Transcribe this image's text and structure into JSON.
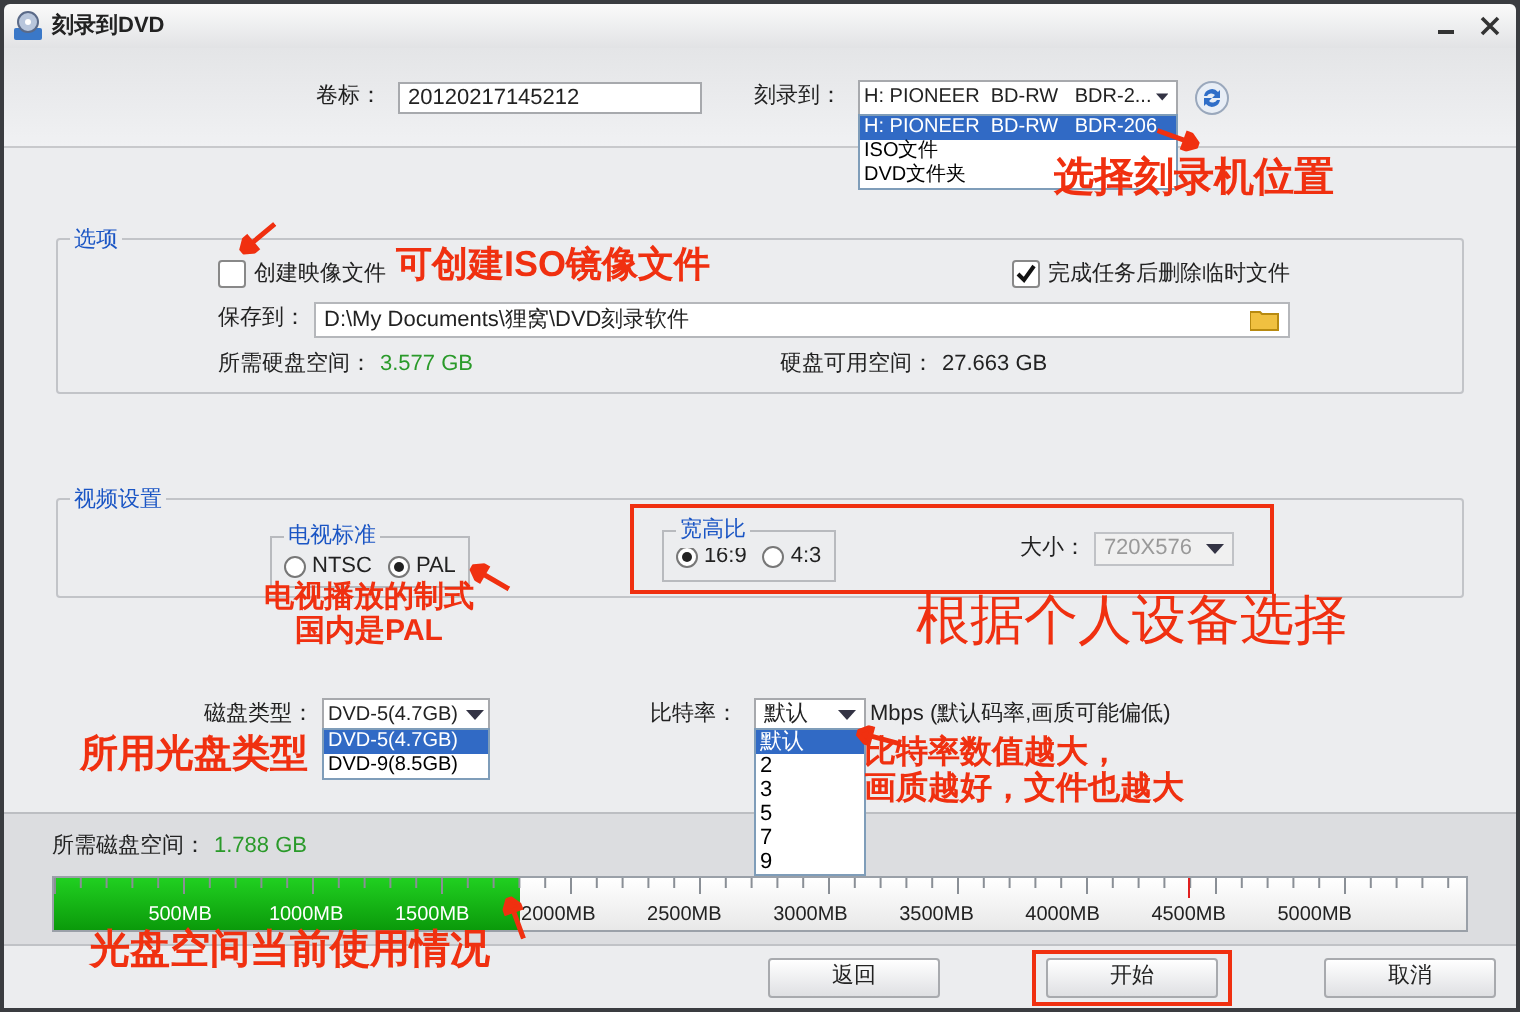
{
  "window": {
    "title": "刻录到DVD"
  },
  "volume": {
    "label": "卷标：",
    "value": "20120217145212"
  },
  "burn_to": {
    "label": "刻录到：",
    "value": "H: PIONEER  BD-RW   BDR-2...",
    "options": [
      {
        "label": "H: PIONEER  BD-RW   BDR-206",
        "selected": true
      },
      {
        "label": "ISO文件",
        "selected": false
      },
      {
        "label": "DVD文件夹",
        "selected": false
      }
    ]
  },
  "options": {
    "title": "选项",
    "create_image": {
      "label": "创建映像文件",
      "checked": false
    },
    "delete_temp": {
      "label": "完成任务后删除临时文件",
      "checked": true
    },
    "save_to": {
      "label": "保存到：",
      "value": "D:\\My Documents\\狸窝\\DVD刻录软件"
    },
    "required_space": {
      "label": "所需硬盘空间：",
      "value": "3.577 GB"
    },
    "free_space": {
      "label": "硬盘可用空间：",
      "value": "27.663 GB"
    }
  },
  "video": {
    "title": "视频设置",
    "tv_standard": {
      "title": "电视标准",
      "options": [
        {
          "label": "NTSC",
          "selected": false
        },
        {
          "label": "PAL",
          "selected": true
        }
      ]
    },
    "aspect": {
      "title": "宽高比",
      "options": [
        {
          "label": "16:9",
          "selected": true
        },
        {
          "label": "4:3",
          "selected": false
        }
      ]
    },
    "size": {
      "label": "大小：",
      "value": "720X576",
      "disabled": true
    }
  },
  "disc_type": {
    "label": "磁盘类型：",
    "value": "DVD-5(4.7GB)",
    "options": [
      {
        "label": "DVD-5(4.7GB)",
        "selected": true
      },
      {
        "label": "DVD-9(8.5GB)",
        "selected": false
      }
    ]
  },
  "bitrate": {
    "label": "比特率：",
    "value": "默认",
    "unit": "Mbps (默认码率,画质可能偏低)",
    "options": [
      {
        "label": "默认",
        "selected": true
      },
      {
        "label": "2",
        "selected": false
      },
      {
        "label": "3",
        "selected": false
      },
      {
        "label": "5",
        "selected": false
      },
      {
        "label": "7",
        "selected": false
      },
      {
        "label": "9",
        "selected": false
      }
    ]
  },
  "disc_usage": {
    "label": "所需磁盘空间：",
    "value": "1.788 GB",
    "level": 0.33,
    "ticks": [
      "500MB",
      "1000MB",
      "1500MB",
      "2000MB",
      "2500MB",
      "3000MB",
      "3500MB",
      "4000MB",
      "4500MB",
      "5000MB"
    ]
  },
  "buttons": [
    {
      "label": "返回"
    },
    {
      "label": "开始"
    },
    {
      "label": "取消"
    }
  ],
  "annotations": [
    {
      "lines": [
        "选择刻录机位置"
      ]
    },
    {
      "lines": [
        "可创建ISO镜像文件"
      ]
    },
    {
      "lines": [
        "电视播放的制式",
        "国内是PAL"
      ]
    },
    {
      "lines": [
        "根据个人设备选择"
      ]
    },
    {
      "lines": [
        "所用光盘类型"
      ]
    },
    {
      "lines": [
        "比特率数值越大，",
        "画质越好，文件也越大"
      ]
    },
    {
      "lines": [
        "光盘空间当前使用情况"
      ]
    }
  ]
}
